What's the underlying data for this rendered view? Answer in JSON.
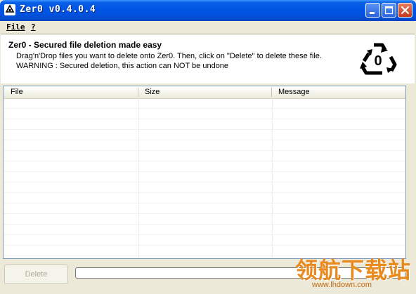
{
  "window": {
    "title": "Zer0 v0.4.0.4"
  },
  "menu": [
    {
      "label": "File"
    },
    {
      "label": "?"
    }
  ],
  "header": {
    "title": "Zer0 - Secured file deletion made easy",
    "line1": "Drag'n'Drop files you want to delete onto Zer0. Then, click on \"Delete\" to delete these file.",
    "line2": "WARNING : Secured deletion, this action can NOT be undone",
    "logo_digit": "0"
  },
  "list": {
    "columns": [
      "File",
      "Size",
      "Message"
    ],
    "rows": []
  },
  "footer": {
    "delete_label": "Delete",
    "progress": 0
  },
  "watermark": {
    "text_cn": "领航下载站",
    "url": "www.lhdown.com"
  },
  "icons": [
    "app-recycle-icon",
    "minimize-icon",
    "maximize-icon",
    "close-icon",
    "recycle-zero-logo-icon"
  ],
  "colors": {
    "titlebar": "#0054e3",
    "close_button": "#c6381a",
    "list_border": "#7f9db9",
    "watermark": "#e98a1e"
  }
}
